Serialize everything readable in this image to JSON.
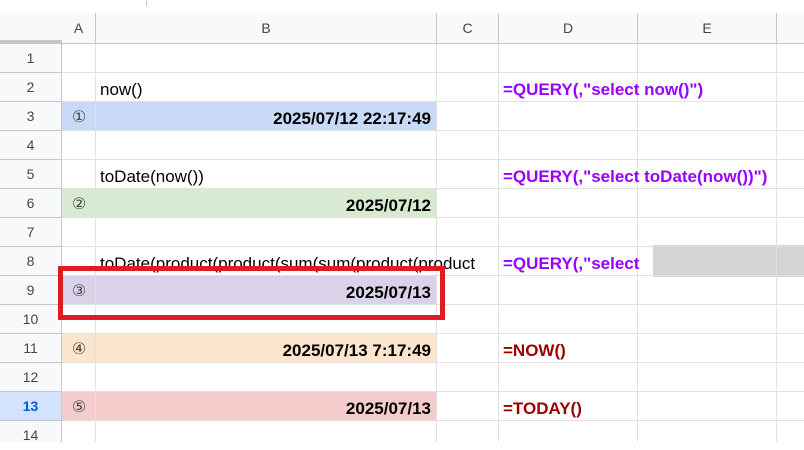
{
  "columns": [
    "A",
    "B",
    "C",
    "D",
    "E"
  ],
  "rows": [
    "1",
    "2",
    "3",
    "4",
    "5",
    "6",
    "7",
    "8",
    "9",
    "10",
    "11",
    "12",
    "13",
    "14"
  ],
  "selected_row": "13",
  "colors": {
    "blue_fill": "#c9daf8",
    "green_fill": "#d9ead3",
    "purple_fill": "#d9d2e9",
    "orange_fill": "#fce5cd",
    "red_fill": "#f4cccc",
    "query_formula": "#9900ff",
    "sheet_formula": "#990000",
    "highlight_box": "#e01b24",
    "gray_block": "#d4d4d4"
  },
  "cells": {
    "B2": "now()",
    "A3": "①",
    "B3": "2025/07/12 22:17:49",
    "B5": "toDate(now())",
    "A6": "②",
    "B6": "2025/07/12",
    "B8": "toDate(product(product(sum(sum(product(product",
    "A9": "③",
    "B9": "2025/07/13",
    "A11": "④",
    "B11": "2025/07/13 7:17:49",
    "A13": "⑤",
    "B13": "2025/07/13",
    "D2": "=QUERY(,\"select now()\")",
    "D5": "=QUERY(,\"select toDate(now())\")",
    "D8": "=QUERY(,\"select ",
    "D11": "=NOW()",
    "D13": "=TODAY()"
  }
}
